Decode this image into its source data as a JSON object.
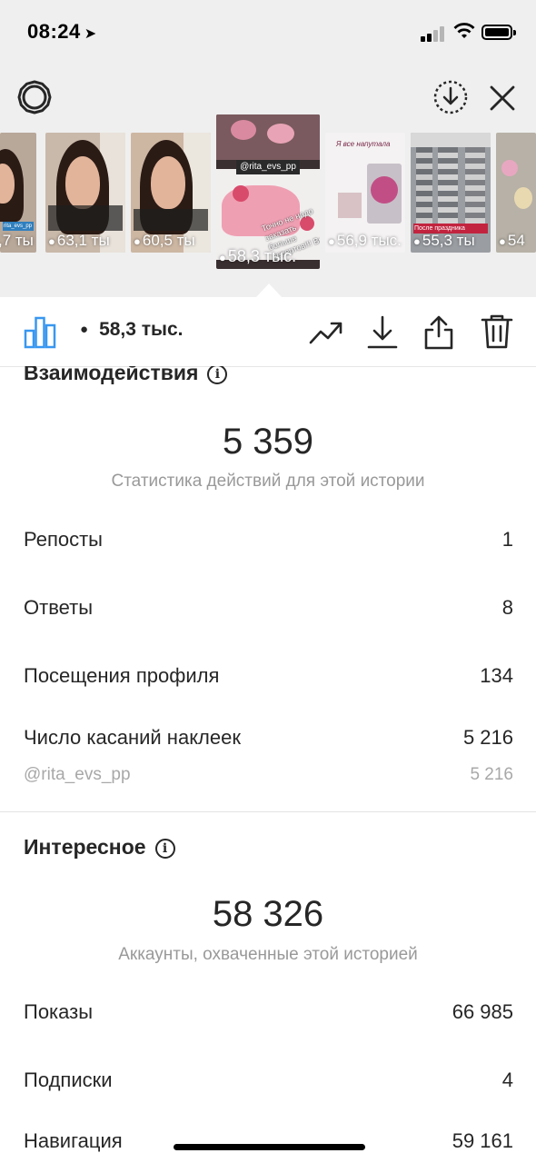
{
  "status_bar": {
    "time": "08:24"
  },
  "stories": [
    {
      "views": ",7 ты",
      "caption": "rita_evs_pp"
    },
    {
      "views": "63,1 ты",
      "caption": ""
    },
    {
      "views": "60,5 ты",
      "caption": ""
    },
    {
      "views": "58,3 тыс.",
      "caption": "@rita_evs_pp",
      "text": "Точно не надо заказать больше десертов!!! Вкус"
    },
    {
      "views": "56,9 тыс.",
      "caption": "Я все напутала"
    },
    {
      "views": "55,3 ты",
      "caption": "После праздника"
    },
    {
      "views": "54",
      "caption": ""
    }
  ],
  "toolbar": {
    "views": "58,3 тыс."
  },
  "interactions": {
    "title": "Взаимодействия",
    "total": "5 359",
    "caption": "Статистика действий для этой истории",
    "rows": [
      {
        "label": "Репосты",
        "value": "1"
      },
      {
        "label": "Ответы",
        "value": "8"
      },
      {
        "label": "Посещения профиля",
        "value": "134"
      },
      {
        "label": "Число касаний наклеек",
        "value": "5 216"
      }
    ],
    "sticker_sub": {
      "label": "@rita_evs_pp",
      "value": "5 216"
    }
  },
  "discovery": {
    "title": "Интересное",
    "total": "58 326",
    "caption": "Аккаунты, охваченные этой историей",
    "rows": [
      {
        "label": "Показы",
        "value": "66 985"
      },
      {
        "label": "Подписки",
        "value": "4"
      },
      {
        "label": "Навигация",
        "value": "59 161"
      }
    ]
  },
  "icons": {
    "settings": "gear-icon",
    "download_all": "download-circle-icon",
    "close": "close-icon",
    "insights": "bar-chart-icon",
    "promote": "trend-icon",
    "download": "download-icon",
    "share": "share-icon",
    "delete": "trash-icon"
  },
  "colors": {
    "accent": "#3897f0",
    "text": "#262626",
    "muted": "#999999"
  }
}
